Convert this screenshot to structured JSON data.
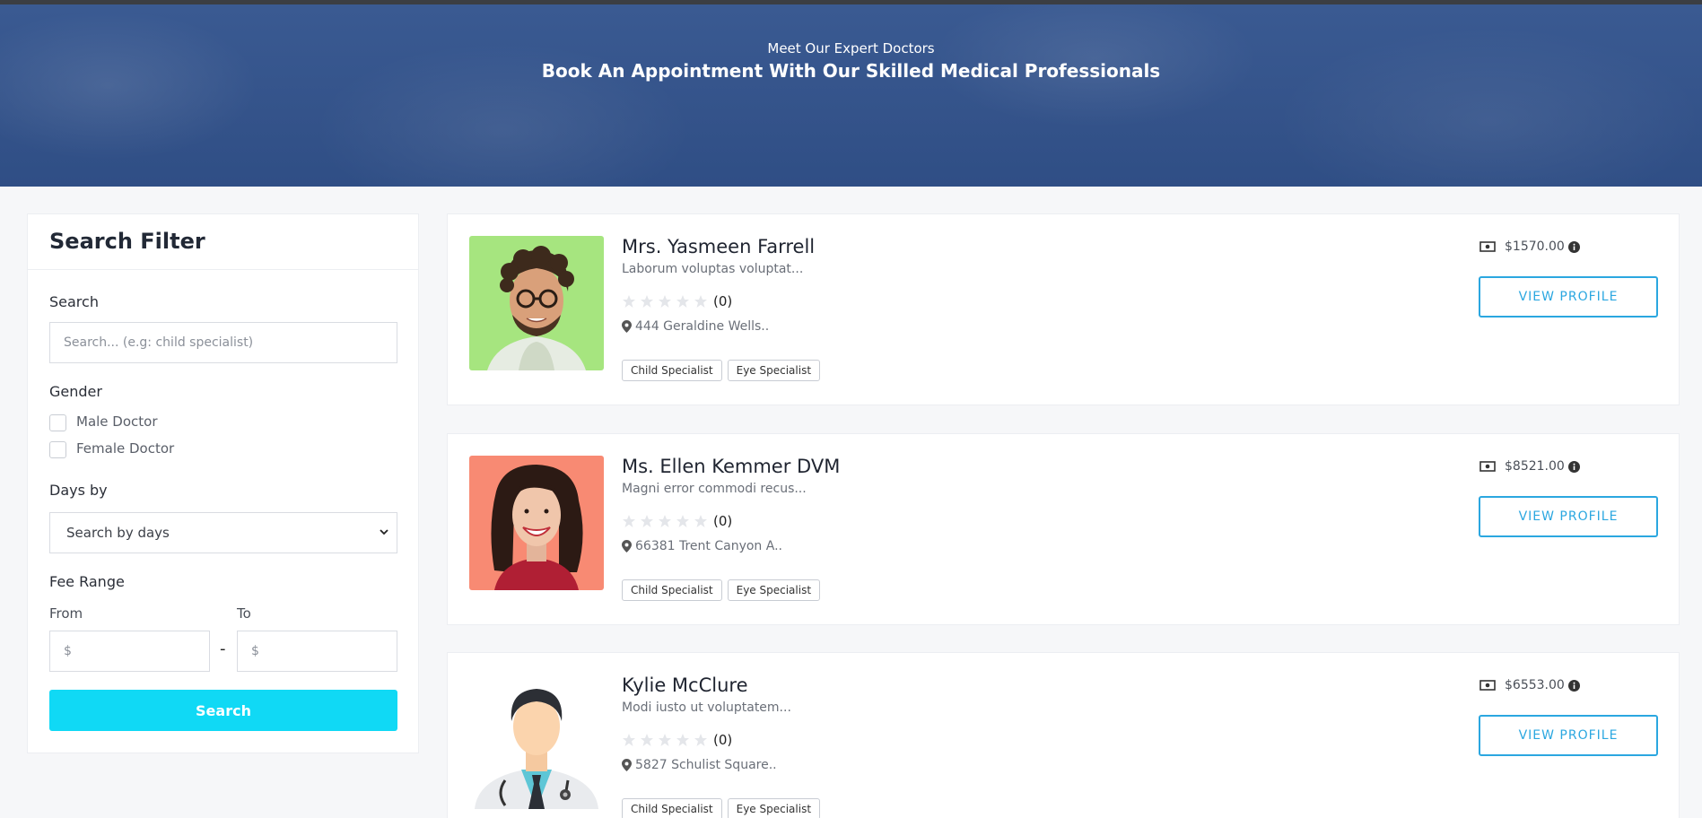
{
  "hero": {
    "subtitle": "Meet Our Expert Doctors",
    "title": "Book An Appointment With Our Skilled Medical Professionals"
  },
  "sidebar": {
    "title": "Search Filter",
    "search_label": "Search",
    "search_placeholder": "Search... (e.g: child specialist)",
    "gender_label": "Gender",
    "gender_options": [
      "Male Doctor",
      "Female Doctor"
    ],
    "days_label": "Days by",
    "days_selected": "Search by days",
    "fee_label": "Fee Range",
    "from_label": "From",
    "to_label": "To",
    "from_placeholder": "$",
    "to_placeholder": "$",
    "range_separator": "-",
    "search_button": "Search"
  },
  "doctors": [
    {
      "name": "Mrs. Yasmeen Farrell",
      "description": "Laborum voluptas voluptat...",
      "rating_count": "(0)",
      "address": "444 Geraldine Wells..",
      "tags": [
        "Child Specialist",
        "Eye Specialist"
      ],
      "fee": "$1570.00",
      "button": "VIEW PROFILE",
      "avatar": "man-with-glasses-green-background"
    },
    {
      "name": "Ms. Ellen Kemmer DVM",
      "description": "Magni error commodi recus...",
      "rating_count": "(0)",
      "address": "66381 Trent Canyon A..",
      "tags": [
        "Child Specialist",
        "Eye Specialist"
      ],
      "fee": "$8521.00",
      "button": "VIEW PROFILE",
      "avatar": "smiling-woman-coral-background"
    },
    {
      "name": "Kylie McClure",
      "description": "Modi iusto ut voluptatem...",
      "rating_count": "(0)",
      "address": "5827 Schulist Square..",
      "tags": [
        "Child Specialist",
        "Eye Specialist"
      ],
      "fee": "$6553.00",
      "button": "VIEW PROFILE",
      "avatar": "doctor-illustration"
    }
  ],
  "colors": {
    "hero": "#34538a",
    "accent": "#2ba7e0",
    "search_button": "#10d9f5"
  }
}
